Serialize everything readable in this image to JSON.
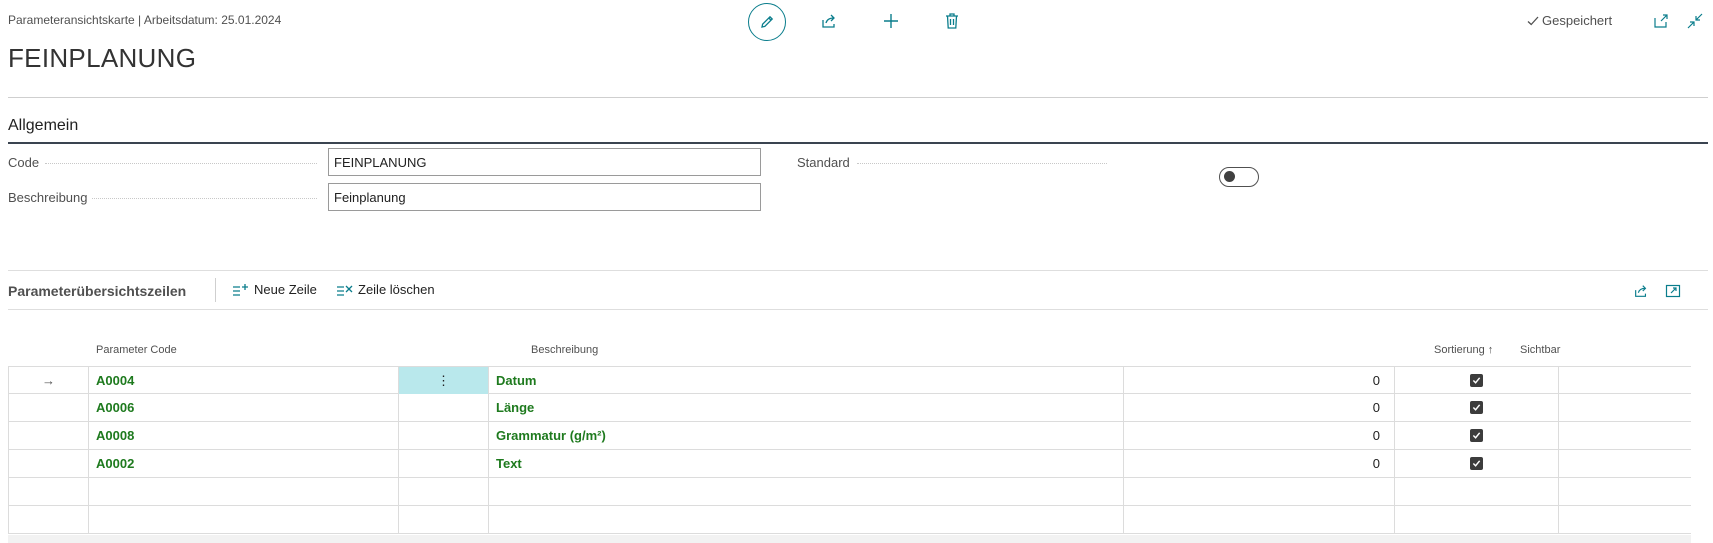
{
  "header": {
    "breadcrumb": "Parameteransichtskarte | Arbeitsdatum: 25.01.2024",
    "title": "FEINPLANUNG",
    "saved_label": "Gespeichert"
  },
  "general": {
    "heading": "Allgemein",
    "code_label": "Code",
    "code_value": "FEINPLANUNG",
    "description_label": "Beschreibung",
    "description_value": "Feinplanung",
    "standard_label": "Standard",
    "standard_on": false
  },
  "lines": {
    "title": "Parameterübersichtszeilen",
    "new_line_label": "Neue Zeile",
    "delete_line_label": "Zeile löschen",
    "columns": {
      "code": "Parameter Code",
      "description": "Beschreibung",
      "sort": "Sortierung",
      "sort_indicator": "↑",
      "visible": "Sichtbar"
    },
    "rows": [
      {
        "code": "A0004",
        "description": "Datum",
        "sort": "0",
        "visible": true
      },
      {
        "code": "A0006",
        "description": "Länge",
        "sort": "0",
        "visible": true
      },
      {
        "code": "A0008",
        "description": "Grammatur (g/m²)",
        "sort": "0",
        "visible": true
      },
      {
        "code": "A0002",
        "description": "Text",
        "sort": "0",
        "visible": true
      }
    ],
    "current_row_marker": "→",
    "row_menu_glyph": "⋮"
  },
  "colors": {
    "accent": "#0a7d8c",
    "link_green": "#1e7a1e",
    "active_cell": "#b9e8ec"
  },
  "icons": [
    "edit-icon",
    "share-icon",
    "plus-icon",
    "trash-icon",
    "checkmark-icon",
    "popout-icon",
    "collapse-icon",
    "new-line-icon",
    "delete-line-icon",
    "share-lines-icon",
    "expand-icon"
  ]
}
